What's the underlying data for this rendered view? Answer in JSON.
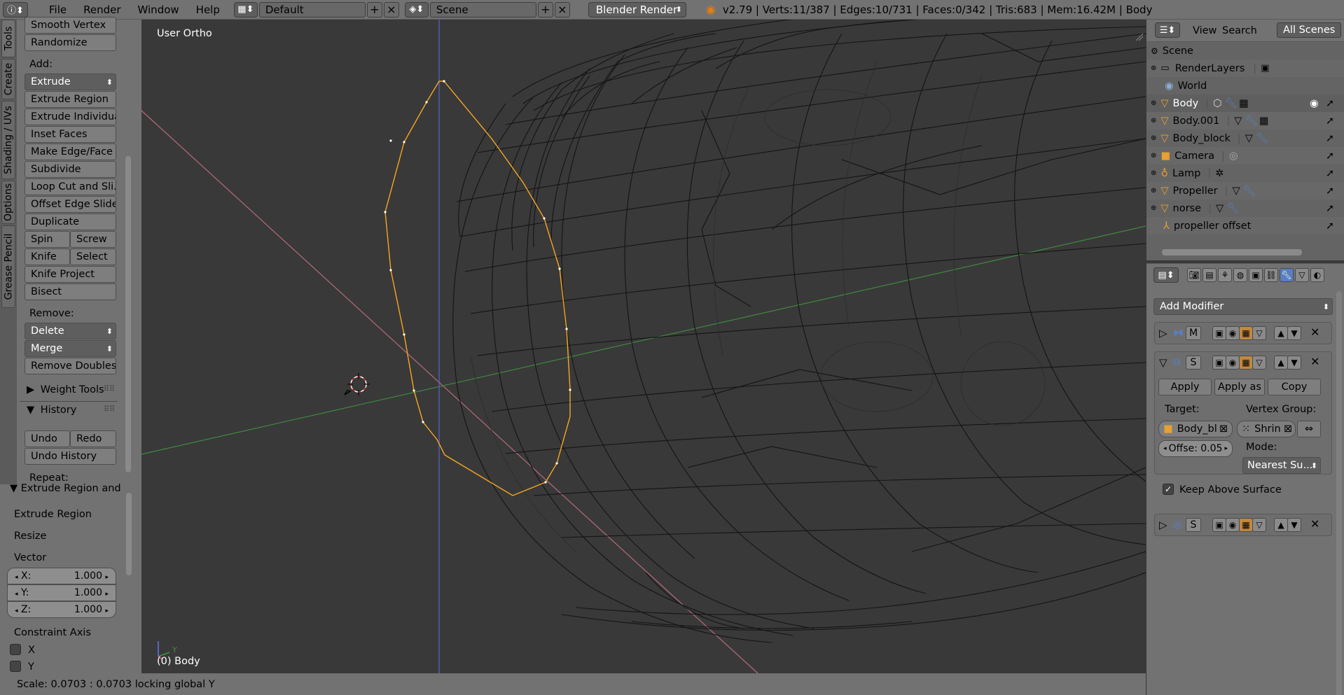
{
  "topbar": {
    "menus": [
      "File",
      "Render",
      "Window",
      "Help"
    ],
    "layout_name": "Default",
    "scene_name": "Scene",
    "engine": "Blender Render",
    "stats": "v2.79 | Verts:11/387 | Edges:10/731 | Faces:0/342 | Tris:683 | Mem:16.42M | Body"
  },
  "tabs": [
    "Tools",
    "Create",
    "Shading / UVs",
    "Options",
    "Grease Pencil"
  ],
  "tools": {
    "smooth_vertex": "Smooth Vertex",
    "randomize": "Randomize",
    "add_label": "Add:",
    "extrude": "Extrude",
    "extrude_region": "Extrude Region",
    "extrude_individual": "Extrude Individual",
    "inset_faces": "Inset Faces",
    "make_edge_face": "Make Edge/Face",
    "subdivide": "Subdivide",
    "loop_cut": "Loop Cut and Sli...",
    "offset_edge_slide": "Offset Edge Slide",
    "duplicate": "Duplicate",
    "spin": "Spin",
    "screw": "Screw",
    "knife": "Knife",
    "select": "Select",
    "knife_project": "Knife Project",
    "bisect": "Bisect",
    "remove_label": "Remove:",
    "delete": "Delete",
    "merge": "Merge",
    "remove_doubles": "Remove Doubles",
    "weight_tools": "Weight Tools",
    "history": "History",
    "undo": "Undo",
    "redo": "Redo",
    "undo_history": "Undo History",
    "repeat_label": "Repeat:"
  },
  "redo_panel": {
    "title": "Extrude Region and",
    "extrude_region": "Extrude Region",
    "resize": "Resize",
    "vector_label": "Vector",
    "x_label": "X:",
    "x_value": "1.000",
    "y_label": "Y:",
    "y_value": "1.000",
    "z_label": "Z:",
    "z_value": "1.000",
    "constraint_label": "Constraint Axis",
    "cx": "X",
    "cy": "Y"
  },
  "viewport": {
    "view_label": "User Ortho",
    "object_label": "(0) Body",
    "axis_x": "X",
    "axis_y": "Y"
  },
  "status": "Scale: 0.0703 : 0.0703 locking global Y",
  "outliner": {
    "view": "View",
    "search": "Search",
    "all_scenes": "All Scenes",
    "items": [
      {
        "label": "Scene"
      },
      {
        "label": "RenderLayers"
      },
      {
        "label": "World"
      },
      {
        "label": "Body"
      },
      {
        "label": "Body.001"
      },
      {
        "label": "Body_block"
      },
      {
        "label": "Camera"
      },
      {
        "label": "Lamp"
      },
      {
        "label": "Propeller"
      },
      {
        "label": "norse"
      },
      {
        "label": "propeller offset"
      }
    ]
  },
  "properties": {
    "add_modifier": "Add Modifier",
    "mod1_tag": "M",
    "mod2_tag": "S",
    "apply": "Apply",
    "apply_as": "Apply as S",
    "copy": "Copy",
    "target_label": "Target:",
    "vgroup_label": "Vertex Group:",
    "target_value": "Body_bl",
    "vgroup_value": "Shrin",
    "offset": "Offse: 0.05",
    "mode_label": "Mode:",
    "mode_value": "Nearest Su...",
    "keep_above": "Keep Above Surface",
    "mod3_tag": "S"
  },
  "colors": {
    "ui_gray": "#727272",
    "viewport_bg": "#393939",
    "selection_orange": "#f5a623",
    "x_axis_red": "#c06070",
    "y_axis_green": "#3f8a3f",
    "z_axis_blue": "#5a64c8",
    "modifier_blue": "#5a7fbf"
  }
}
